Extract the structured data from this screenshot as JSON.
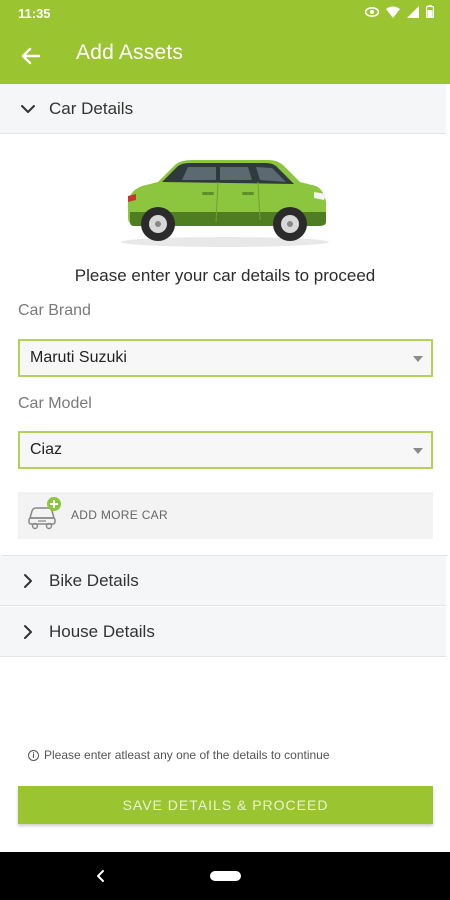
{
  "status": {
    "time": "11:35"
  },
  "appbar": {
    "title": "Add Assets",
    "back_icon": "arrow-left-icon"
  },
  "accordion": {
    "car": {
      "label": "Car Details",
      "expanded": true
    },
    "bike": {
      "label": "Bike Details",
      "expanded": false
    },
    "house": {
      "label": "House Details",
      "expanded": false
    }
  },
  "car_form": {
    "prompt": "Please enter your car details to proceed",
    "brand_label": "Car Brand",
    "brand_value": "Maruti Suzuki",
    "model_label": "Car Model",
    "model_value": "Ciaz",
    "add_more_label": "ADD MORE CAR"
  },
  "footer": {
    "note": "Please enter atleast any one of the details to continue",
    "save_label": "SAVE DETAILS & PROCEED"
  },
  "colors": {
    "accent": "#9bc431",
    "field_border": "#b4d25a",
    "header_bg": "#f5f6f7"
  }
}
